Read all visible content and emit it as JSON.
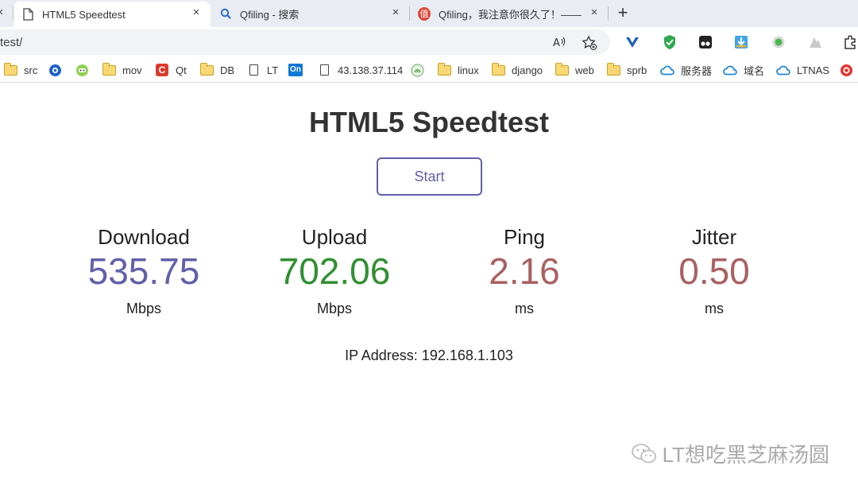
{
  "tabs": [
    {
      "title": "HTML5 Speedtest",
      "icon": "page-icon",
      "active": true
    },
    {
      "title": "Qfiling - 搜索",
      "icon": "search-icon",
      "active": false
    },
    {
      "title": "Qfiling，我注意你很久了！——阝",
      "icon": "zhi-icon",
      "active": false
    }
  ],
  "tab_icon_glyphs": {
    "zhi": "值",
    "close": "×",
    "plus": "+"
  },
  "address_bar": {
    "url": "test/"
  },
  "bookmarks": [
    {
      "label": "src",
      "icon": "folder-icon"
    },
    {
      "label": "",
      "icon": "blue-circle-icon"
    },
    {
      "label": "",
      "icon": "green-face-icon"
    },
    {
      "label": "mov",
      "icon": "folder-icon"
    },
    {
      "label": "Qt",
      "icon": "red-c-icon",
      "glyph": "C"
    },
    {
      "label": "DB",
      "icon": "folder-icon"
    },
    {
      "label": "LT",
      "icon": "page-icon"
    },
    {
      "label": "",
      "icon": "onenote-icon",
      "glyph": "On"
    },
    {
      "label": "43.138.37.114",
      "icon": "page-icon"
    },
    {
      "label": "",
      "icon": "android-icon"
    },
    {
      "label": "linux",
      "icon": "folder-icon"
    },
    {
      "label": "django",
      "icon": "folder-icon"
    },
    {
      "label": "web",
      "icon": "folder-icon"
    },
    {
      "label": "sprb",
      "icon": "folder-icon"
    },
    {
      "label": "服务器",
      "icon": "cloud-icon"
    },
    {
      "label": "域名",
      "icon": "cloud-icon"
    },
    {
      "label": "LTNAS",
      "icon": "cloud-icon"
    },
    {
      "label": "",
      "icon": "red-orange-icon"
    }
  ],
  "page": {
    "title": "HTML5 Speedtest",
    "start_label": "Start",
    "ip_label": "IP Address: 192.168.1.103"
  },
  "meters": [
    {
      "label": "Download",
      "value": "535.75",
      "unit": "Mbps",
      "color": "#6060aa"
    },
    {
      "label": "Upload",
      "value": "702.06",
      "unit": "Mbps",
      "color": "#309030"
    },
    {
      "label": "Ping",
      "value": "2.16",
      "unit": "ms",
      "color": "#aa6060"
    },
    {
      "label": "Jitter",
      "value": "0.50",
      "unit": "ms",
      "color": "#aa6060"
    }
  ],
  "watermark": {
    "text": "LT想吃黑芝麻汤圆",
    "icon": "wechat-icon"
  }
}
